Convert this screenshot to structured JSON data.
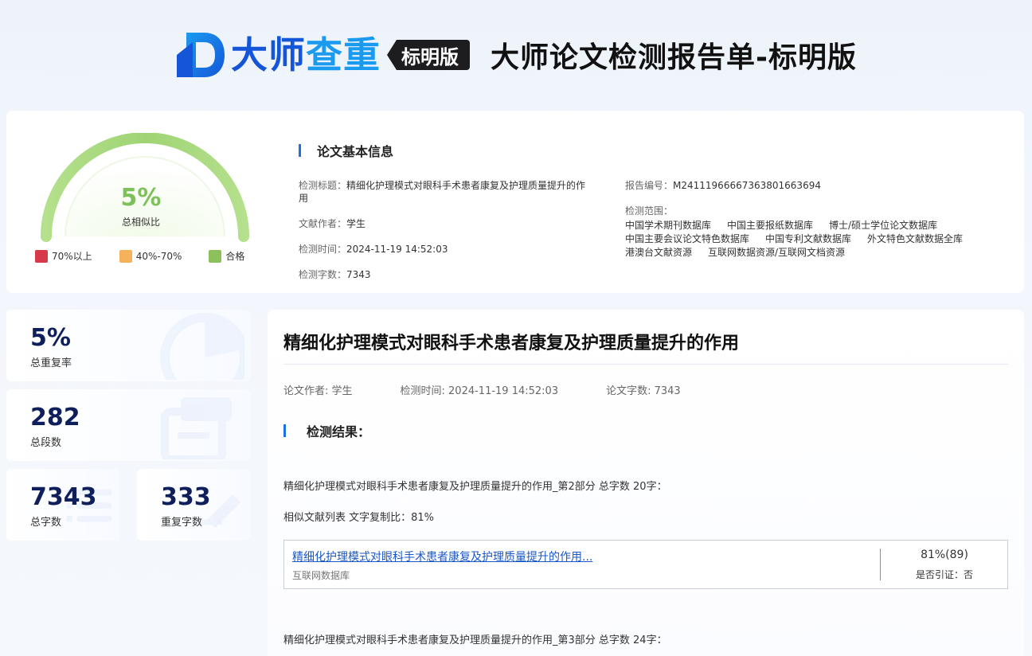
{
  "header": {
    "brand_part1": "大师",
    "brand_part2": "查重",
    "badge": "标明版",
    "title": "大师论文检测报告单-标明版"
  },
  "gauge": {
    "percent": "5%",
    "value": 5,
    "label": "总相似比",
    "color": "#7ec05a"
  },
  "legend": [
    {
      "label": "70%以上",
      "color": "#d63a4a"
    },
    {
      "label": "40%-70%",
      "color": "#f5b25b"
    },
    {
      "label": "合格",
      "color": "#8cc05a"
    }
  ],
  "info": {
    "heading": "论文基本信息",
    "title_key": "检测标题：",
    "title_val": "精细化护理模式对眼科手术患者康复及护理质量提升的作用",
    "author_key": "文献作者：",
    "author_val": "学生",
    "time_key": "检测时间：",
    "time_val": "2024-11-19 14:52:03",
    "words_key": "检测字数：",
    "words_val": "7343",
    "report_key": "报告编号：",
    "report_val": "M24111966667363801663694",
    "scope_key": "检测范围：",
    "scope": [
      "中国学术期刊数据库",
      "中国主要报纸数据库",
      "博士/硕士学位论文数据库",
      "中国主要会议论文特色数据库",
      "中国专利文献数据库",
      "外文特色文献数据全库",
      "港澳台文献资源",
      "互联网数据资源/互联网文档资源"
    ]
  },
  "stats": {
    "rate_num": "5%",
    "rate_label": "总重复率",
    "para_num": "282",
    "para_label": "总段数",
    "words_num": "7343",
    "words_label": "总字数",
    "dup_num": "333",
    "dup_label": "重复字数"
  },
  "main": {
    "title": "精细化护理模式对眼科手术患者康复及护理质量提升的作用",
    "meta_author": "论文作者: 学生",
    "meta_time": "检测时间: 2024-11-19 14:52:03",
    "meta_words": "论文字数: 7343",
    "result_heading": "检测结果：",
    "part2": "精细化护理模式对眼科手术患者康复及护理质量提升的作用_第2部分 总字数 20字：",
    "similar": "相似文献列表 文字复制比：81%",
    "doc_link": "精细化护理模式对眼科手术患者康复及护理质量提升的作用...",
    "doc_source": "互联网数据库",
    "doc_pct": "81%(89)",
    "doc_cite": "是否引证：否",
    "part3": "精细化护理模式对眼科手术患者康复及护理质量提升的作用_第3部分 总字数 24字："
  }
}
